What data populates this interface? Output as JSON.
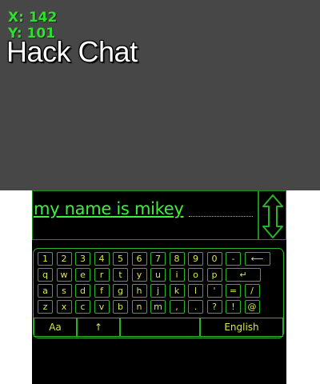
{
  "coords": {
    "x": "X: 142",
    "y": "Y: 101"
  },
  "title": "Hack Chat",
  "input": {
    "value": "my name is mikey"
  },
  "keyboard": {
    "rows": [
      [
        "1",
        "2",
        "3",
        "4",
        "5",
        "6",
        "7",
        "8",
        "9",
        "0",
        "-",
        "⟵"
      ],
      [
        "q",
        "w",
        "e",
        "r",
        "t",
        "y",
        "u",
        "i",
        "o",
        "p",
        "↵"
      ],
      [
        "a",
        "s",
        "d",
        "f",
        "g",
        "h",
        "j",
        "k",
        "l",
        "'",
        "=",
        "/"
      ],
      [
        "z",
        "x",
        "c",
        "v",
        "b",
        "n",
        "m",
        ",",
        ".",
        "?",
        "!",
        "@"
      ]
    ],
    "bottom": {
      "caps": "Aa",
      "shift": "↑",
      "space": "",
      "language": "English"
    }
  },
  "colors": {
    "accent_green": "#2ee02e",
    "key_text": "#d8e84a",
    "border_green": "#27b427"
  }
}
